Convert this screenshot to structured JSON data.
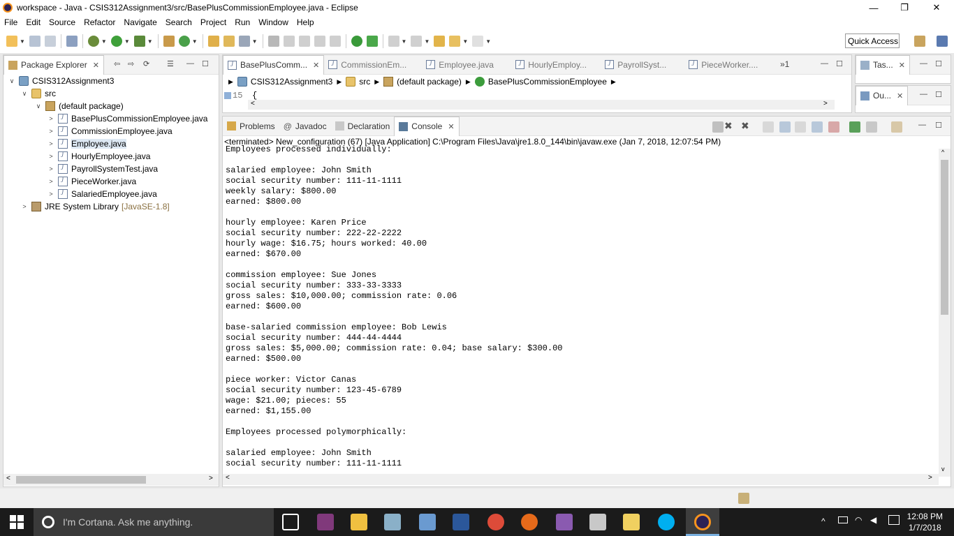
{
  "window": {
    "title": "workspace - Java - CSIS312Assignment3/src/BasePlusCommissionEmployee.java - Eclipse",
    "minimize_glyph": "—",
    "restore_glyph": "❐",
    "close_glyph": "✕"
  },
  "menu": [
    "File",
    "Edit",
    "Source",
    "Refactor",
    "Navigate",
    "Search",
    "Project",
    "Run",
    "Window",
    "Help"
  ],
  "toolbar": {
    "quick_access": "Quick Access"
  },
  "package_explorer": {
    "tab_label": "Package Explorer",
    "project": "CSIS312Assignment3",
    "src": "src",
    "package": "(default package)",
    "files": [
      "BasePlusCommissionEmployee.java",
      "CommissionEmployee.java",
      "Employee.java",
      "HourlyEmployee.java",
      "PayrollSystemTest.java",
      "PieceWorker.java",
      "SalariedEmployee.java"
    ],
    "selected_file": "Employee.java",
    "library": "JRE System Library",
    "library_version": "[JavaSE-1.8]"
  },
  "editor": {
    "tabs": [
      "BasePlusComm...",
      "CommissionEm...",
      "Employee.java",
      "HourlyEmploy...",
      "PayrollSyst...",
      "PieceWorker...."
    ],
    "overflow_label": "»1",
    "breadcrumb": [
      "CSIS312Assignment3",
      "src",
      "(default package)",
      "BasePlusCommissionEmployee"
    ],
    "line_number": "15",
    "line_code": "{"
  },
  "right_views": {
    "tasks_tab": "Tas...",
    "outline_tab": "Ou..."
  },
  "bottom_tabs": {
    "problems": "Problems",
    "javadoc": "Javadoc",
    "declaration": "Declaration",
    "console": "Console"
  },
  "console": {
    "header": "<terminated> New_configuration (67) [Java Application] C:\\Program Files\\Java\\jre1.8.0_144\\bin\\javaw.exe (Jan 7, 2018, 12:07:54 PM)",
    "output": "Employees processed individually:\n\nsalaried employee: John Smith\nsocial security number: 111-11-1111\nweekly salary: $800.00\nearned: $800.00\n\nhourly employee: Karen Price\nsocial security number: 222-22-2222\nhourly wage: $16.75; hours worked: 40.00\nearned: $670.00\n\ncommission employee: Sue Jones\nsocial security number: 333-33-3333\ngross sales: $10,000.00; commission rate: 0.06\nearned: $600.00\n\nbase-salaried commission employee: Bob Lewis\nsocial security number: 444-44-4444\ngross sales: $5,000.00; commission rate: 0.04; base salary: $300.00\nearned: $500.00\n\npiece worker: Victor Canas\nsocial security number: 123-45-6789\nwage: $21.00; pieces: 55\nearned: $1,155.00\n\nEmployees processed polymorphically:\n\nsalaried employee: John Smith\nsocial security number: 111-11-1111"
  },
  "taskbar": {
    "cortana_placeholder": "I'm Cortana. Ask me anything.",
    "time": "12:08 PM",
    "date": "1/7/2018"
  }
}
